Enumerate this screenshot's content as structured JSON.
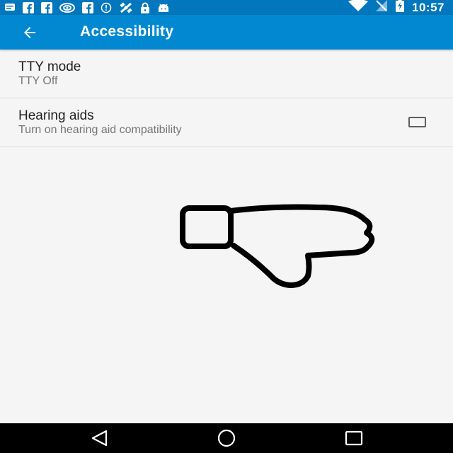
{
  "status_bar": {
    "time": "10:57",
    "left_icons": [
      "message-icon",
      "facebook-icon",
      "facebook-icon",
      "nvidia-icon",
      "facebook-icon",
      "info-icon",
      "satellite-icon",
      "lock-icon",
      "android-icon"
    ],
    "right_icons": [
      "wifi-icon",
      "no-signal-icon",
      "battery-charging-icon"
    ],
    "background_color": "#0277bd"
  },
  "app_bar": {
    "title": "Accessibility",
    "back_icon": "arrow-left-icon",
    "background_color": "#0288d1"
  },
  "settings": {
    "items": [
      {
        "title": "TTY mode",
        "summary": "TTY Off"
      },
      {
        "title": "Hearing aids",
        "summary": "Turn on hearing aid compatibility",
        "checked": false
      }
    ]
  },
  "overlay": {
    "icon": "thumbs-down-icon"
  },
  "nav_bar": {
    "buttons": [
      "back-triangle-icon",
      "home-circle-icon",
      "recents-square-icon"
    ]
  }
}
